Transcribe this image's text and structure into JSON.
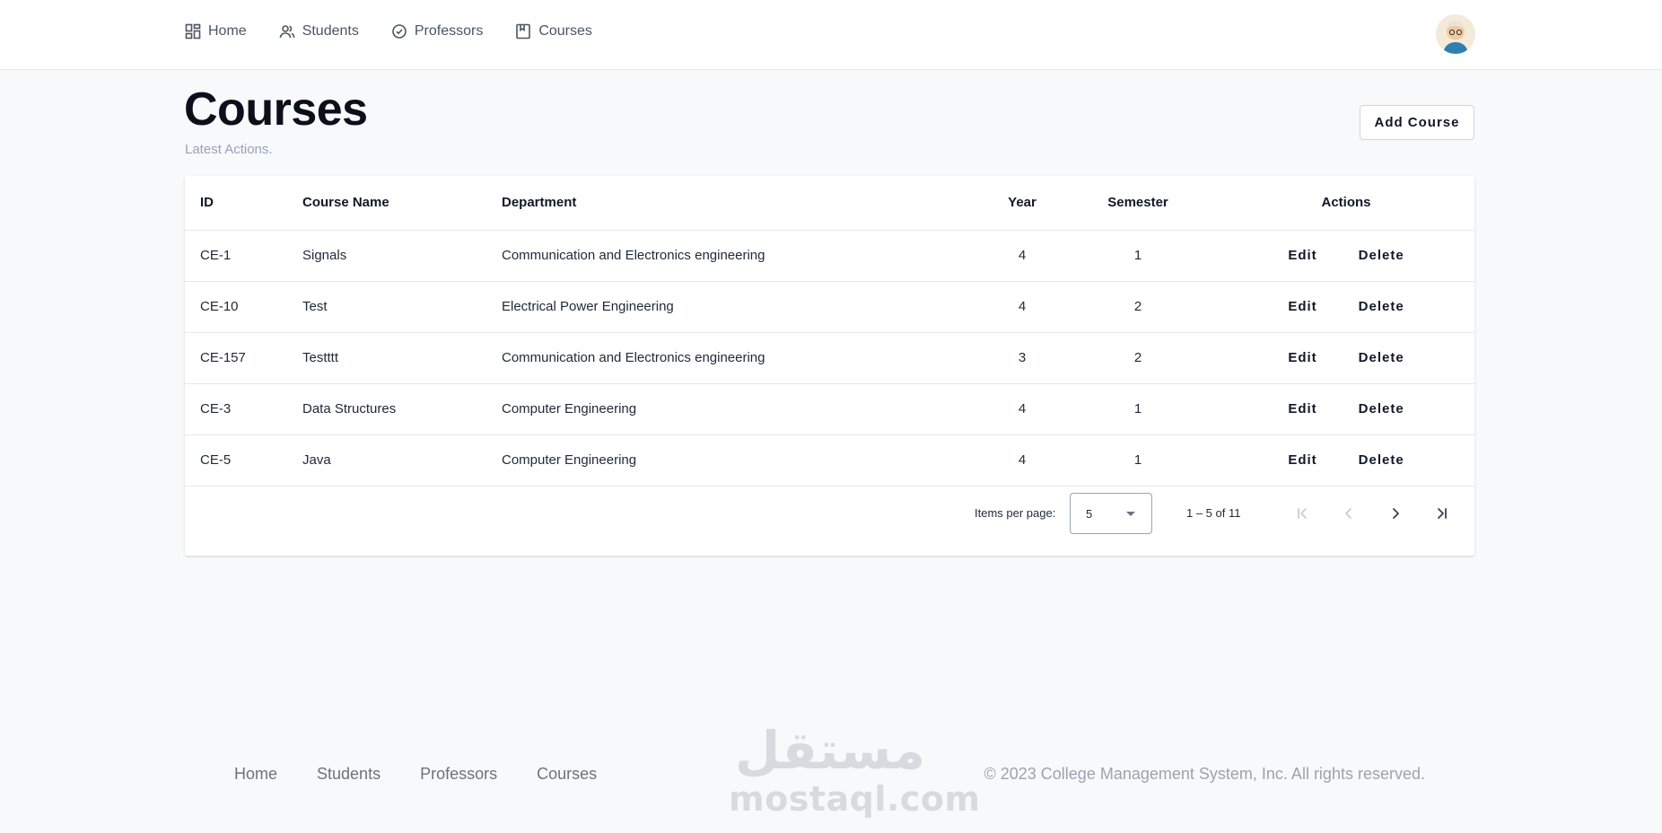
{
  "nav": {
    "items": [
      {
        "label": "Home",
        "icon": "dashboard-icon"
      },
      {
        "label": "Students",
        "icon": "users-icon"
      },
      {
        "label": "Professors",
        "icon": "badge-check-icon"
      },
      {
        "label": "Courses",
        "icon": "bookmark-icon"
      }
    ]
  },
  "header": {
    "title": "Courses",
    "subtitle": "Latest Actions.",
    "add_button": "Add Course"
  },
  "table": {
    "columns": [
      "ID",
      "Course Name",
      "Department",
      "Year",
      "Semester",
      "Actions"
    ],
    "rows": [
      {
        "id": "CE-1",
        "name": "Signals",
        "department": "Communication and Electronics engineering",
        "year": "4",
        "semester": "1"
      },
      {
        "id": "CE-10",
        "name": "Test",
        "department": "Electrical Power Engineering",
        "year": "4",
        "semester": "2"
      },
      {
        "id": "CE-157",
        "name": "Testttt",
        "department": "Communication and Electronics engineering",
        "year": "3",
        "semester": "2"
      },
      {
        "id": "CE-3",
        "name": "Data Structures",
        "department": "Computer Engineering",
        "year": "4",
        "semester": "1"
      },
      {
        "id": "CE-5",
        "name": "Java",
        "department": "Computer Engineering",
        "year": "4",
        "semester": "1"
      }
    ],
    "edit_label": "Edit",
    "delete_label": "Delete"
  },
  "paginator": {
    "items_per_page_label": "Items per page:",
    "page_size": "5",
    "range_label": "1 – 5 of 11"
  },
  "footer": {
    "links": [
      "Home",
      "Students",
      "Professors",
      "Courses"
    ],
    "copyright": "© 2023 College Management System, Inc. All rights reserved."
  },
  "watermark": {
    "arabic": "مستقل",
    "latin": "mostaql.com"
  }
}
